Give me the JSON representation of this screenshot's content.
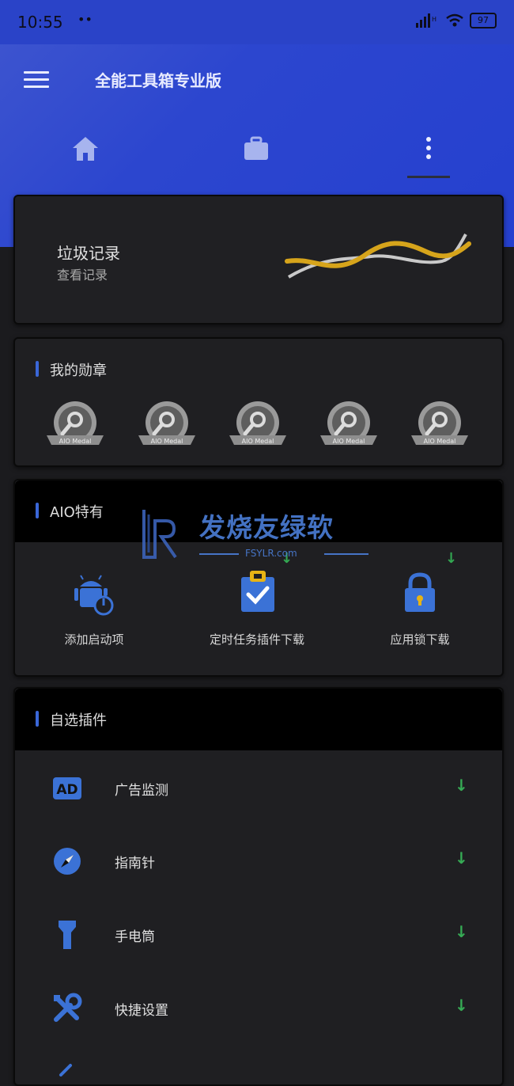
{
  "status_bar": {
    "time": "10:55",
    "dots": "••",
    "battery": "97"
  },
  "app_bar": {
    "title": "全能工具箱专业版"
  },
  "tabs": [
    {
      "name": "home",
      "icon": "home-icon"
    },
    {
      "name": "toolbox",
      "icon": "briefcase-icon"
    },
    {
      "name": "more",
      "icon": "more-vertical-icon"
    }
  ],
  "trash_card": {
    "title": "垃圾记录",
    "subtitle": "查看记录"
  },
  "medals": {
    "title": "我的勋章",
    "items": [
      {
        "label": "AIO Medal"
      },
      {
        "label": "AIO Medal"
      },
      {
        "label": "AIO Medal"
      },
      {
        "label": "AIO Medal"
      },
      {
        "label": "AIO Medal"
      }
    ]
  },
  "aio": {
    "title": "AIO特有",
    "items": [
      {
        "label": "添加启动项",
        "icon": "android-power-icon",
        "download": false
      },
      {
        "label": "定时任务插件下载",
        "icon": "task-clipboard-icon",
        "download": true
      },
      {
        "label": "应用锁下载",
        "icon": "lock-icon",
        "download": true
      }
    ]
  },
  "plugins": {
    "title": "自选插件",
    "items": [
      {
        "label": "广告监测",
        "icon": "ad-icon"
      },
      {
        "label": "指南针",
        "icon": "compass-icon"
      },
      {
        "label": "手电筒",
        "icon": "flashlight-icon"
      },
      {
        "label": "快捷设置",
        "icon": "tools-icon"
      }
    ]
  },
  "watermark": {
    "text": "发烧友绿软",
    "sub": "FSYLR.com"
  },
  "colors": {
    "header": "#2a43c8",
    "accent": "#3a67d8",
    "download": "#36ab55",
    "wave_gold": "#d6a41b"
  }
}
